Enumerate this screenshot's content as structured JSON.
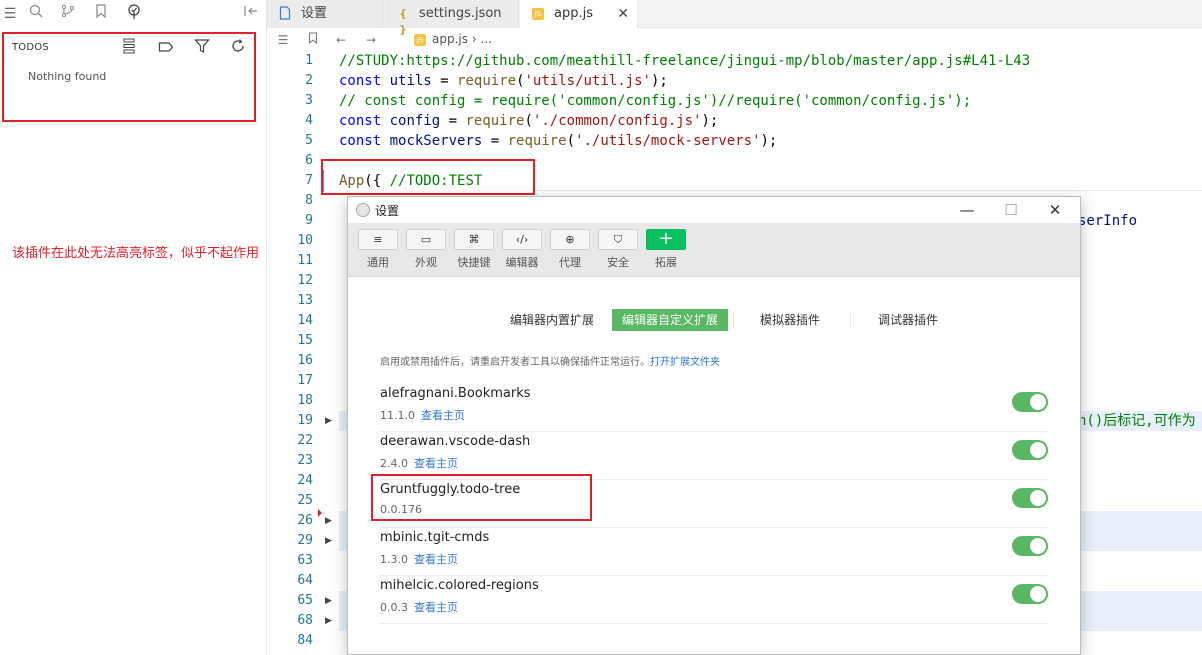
{
  "sidebar": {
    "panel_title": "TODOS",
    "empty_text": "Nothing found",
    "annotation": "该插件在此处无法高亮标签，似乎不起作用"
  },
  "tabs": [
    {
      "label": "设置",
      "icon": "file-icon"
    },
    {
      "label": "settings.json",
      "icon": "json-braces-icon"
    },
    {
      "label": "app.js",
      "icon": "js-file-icon",
      "active": true
    }
  ],
  "breadcrumb": {
    "file": "app.js",
    "rest": "› ..."
  },
  "editor": {
    "lines": [
      {
        "num": "1",
        "text": "//STUDY:https://github.com/meathill-freelance/jingui-mp/blob/master/app.js#L41-L43"
      },
      {
        "num": "2",
        "text": "const utils = require('utils/util.js');"
      },
      {
        "num": "3",
        "text": "// const config = require('common/config.js')//require('common/config.js');"
      },
      {
        "num": "4",
        "text": "const config = require('./common/config.js');"
      },
      {
        "num": "5",
        "text": "const mockServers = require('./utils/mock-servers');"
      },
      {
        "num": "6",
        "text": ""
      },
      {
        "num": "7",
        "text": "App({ //TODO:TEST"
      },
      {
        "num": "8",
        "text": ""
      },
      {
        "num": "9",
        "text": "serInfo"
      },
      {
        "num": "10",
        "text": ""
      },
      {
        "num": "11",
        "text": ""
      },
      {
        "num": "12",
        "text": ""
      },
      {
        "num": "13",
        "text": ""
      },
      {
        "num": "14",
        "text": ""
      },
      {
        "num": "15",
        "text": ""
      },
      {
        "num": "16",
        "text": ""
      },
      {
        "num": "17",
        "text": ""
      },
      {
        "num": "18",
        "text": ""
      },
      {
        "num": "19",
        "text": "n()后标记,可作为"
      },
      {
        "num": "22",
        "text": ""
      },
      {
        "num": "23",
        "text": ""
      },
      {
        "num": "24",
        "text": ""
      },
      {
        "num": "25",
        "text": ""
      },
      {
        "num": "26",
        "text": ""
      },
      {
        "num": "29",
        "text": ""
      },
      {
        "num": "63",
        "text": ""
      },
      {
        "num": "64",
        "text": ""
      },
      {
        "num": "65",
        "text": ""
      },
      {
        "num": "68",
        "text": ""
      },
      {
        "num": "84",
        "text": ""
      }
    ]
  },
  "dialog": {
    "title": "设置",
    "toolbar": [
      {
        "label": "通用",
        "icon": "sliders-icon"
      },
      {
        "label": "外观",
        "icon": "layout-icon"
      },
      {
        "label": "快捷键",
        "icon": "command-key-icon"
      },
      {
        "label": "编辑器",
        "icon": "code-slash-icon",
        "glyph": "‹/›"
      },
      {
        "label": "代理",
        "icon": "globe-icon"
      },
      {
        "label": "安全",
        "icon": "shield-icon"
      },
      {
        "label": "拓展",
        "icon": "plus-icon",
        "glyph": "+"
      }
    ],
    "subtabs": [
      {
        "label": "编辑器内置扩展"
      },
      {
        "label": "编辑器自定义扩展",
        "active": true
      },
      {
        "label": "模拟器插件"
      },
      {
        "label": "调试器插件"
      }
    ],
    "hint": "启用或禁用插件后，请重启开发者工具以确保插件正常运行。",
    "hint_link": "打开扩展文件夹",
    "extensions": [
      {
        "name": "alefragnani.Bookmarks",
        "version": "11.1.0",
        "link": "查看主页",
        "enabled": true
      },
      {
        "name": "deerawan.vscode-dash",
        "version": "2.4.0",
        "link": "查看主页",
        "enabled": true
      },
      {
        "name": "Gruntfuggly.todo-tree",
        "version": "0.0.176",
        "link": "",
        "enabled": true
      },
      {
        "name": "mbinic.tgit-cmds",
        "version": "1.3.0",
        "link": "查看主页",
        "enabled": true
      },
      {
        "name": "mihelcic.colored-regions",
        "version": "0.0.3",
        "link": "查看主页",
        "enabled": true
      }
    ]
  },
  "colors": {
    "accent_green": "#5ab865",
    "annotation_red": "#e0202a",
    "link_blue": "#2f76d5"
  }
}
